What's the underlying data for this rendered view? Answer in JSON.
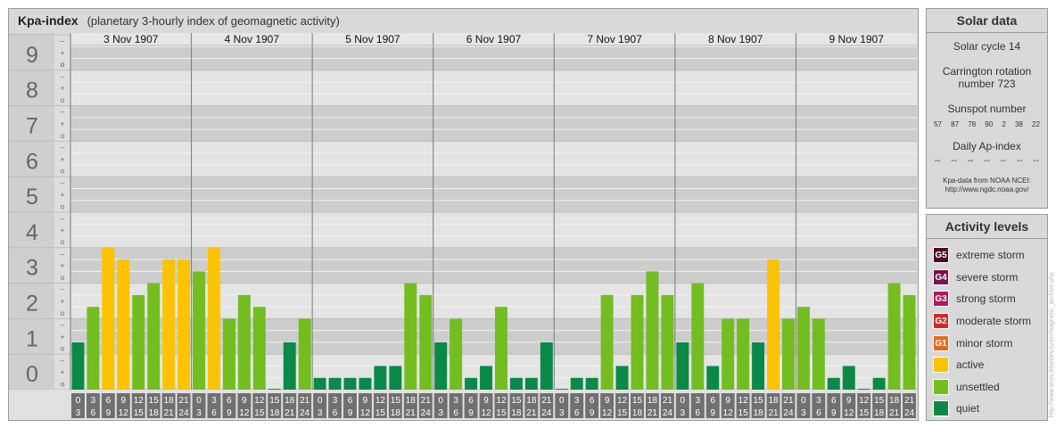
{
  "header": {
    "title": "Kpa-index",
    "subtitle": "(planetary 3-hourly index of geomagnetic activity)"
  },
  "chart_data": {
    "type": "bar",
    "title": "Kpa-index",
    "subtitle": "(planetary 3-hourly index of geomagnetic activity)",
    "ylim": [
      0,
      9
    ],
    "y_ticks": [
      "0",
      "1",
      "2",
      "3",
      "4",
      "5",
      "6",
      "7",
      "8",
      "9"
    ],
    "sub_ticks": [
      "o",
      "+",
      "–",
      "o"
    ],
    "grid": true,
    "days": [
      "3 Nov 1907",
      "4 Nov 1907",
      "5 Nov 1907",
      "6 Nov 1907",
      "7 Nov 1907",
      "8 Nov 1907",
      "9 Nov 1907"
    ],
    "interval_starts": [
      "0",
      "3",
      "6",
      "9",
      "12",
      "15",
      "18",
      "21"
    ],
    "interval_ends": [
      "3",
      "6",
      "9",
      "12",
      "15",
      "18",
      "21",
      "24"
    ],
    "values": [
      1.333,
      2.333,
      4.0,
      3.667,
      2.667,
      3.0,
      3.667,
      3.667,
      3.333,
      4.0,
      2.0,
      2.667,
      2.333,
      0.0,
      1.333,
      2.0,
      0.333,
      0.333,
      0.333,
      0.333,
      0.667,
      0.667,
      3.0,
      2.667,
      1.333,
      2.0,
      0.333,
      0.667,
      2.333,
      0.333,
      0.333,
      1.333,
      0.0,
      0.333,
      0.333,
      2.667,
      0.667,
      2.667,
      3.333,
      2.667,
      1.333,
      3.0,
      0.667,
      2.0,
      2.0,
      1.333,
      3.667,
      2.0,
      2.333,
      2.0,
      0.333,
      0.667,
      0.0,
      0.333,
      3.0,
      2.667
    ],
    "colors": {
      "quiet": "#0a8a46",
      "unsettled": "#73bd21",
      "active": "#fbc300"
    }
  },
  "solar_data": {
    "heading": "Solar data",
    "solar_cycle": "Solar cycle 14",
    "carrington_line1": "Carrington rotation",
    "carrington_line2": "number 723",
    "sunspot_label": "Sunspot number",
    "sunspots": [
      "57",
      "87",
      "78",
      "90",
      "2",
      "38",
      "22"
    ],
    "ap_label": "Daily Ap-index",
    "ap_values": [
      "--",
      "--",
      "--",
      "--",
      "--",
      "--",
      "--"
    ],
    "source_line1": "Kpa-data from NOAA NCEI:",
    "source_line2": "http://www.ngdc.noaa.gov/"
  },
  "activity_levels": {
    "heading": "Activity levels",
    "items": [
      {
        "badge": "G5",
        "label": "extreme storm",
        "color": "#4a0a2a"
      },
      {
        "badge": "G4",
        "label": "severe storm",
        "color": "#7a1150"
      },
      {
        "badge": "G3",
        "label": "strong storm",
        "color": "#b01860"
      },
      {
        "badge": "G2",
        "label": "moderate storm",
        "color": "#d12a2a"
      },
      {
        "badge": "G1",
        "label": "minor storm",
        "color": "#e56a1a"
      },
      {
        "badge": "",
        "label": "active",
        "color": "#fbc300"
      },
      {
        "badge": "",
        "label": "unsettled",
        "color": "#73bd21"
      },
      {
        "badge": "",
        "label": "quiet",
        "color": "#0a8a46"
      }
    ]
  },
  "credit": "http://www.tesis.lebedev.ru/en/magnetic_archive.php"
}
